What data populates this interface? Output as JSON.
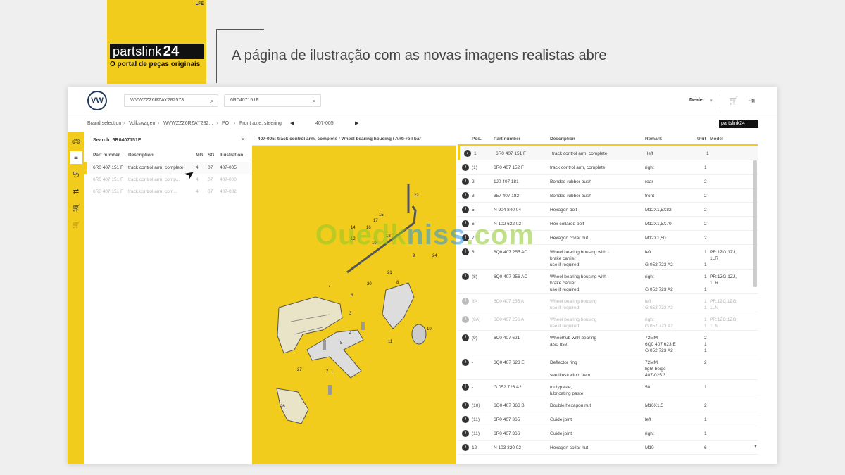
{
  "banner": {
    "logo_text": "partslink",
    "logo_num": "24",
    "tagline": "O portal de peças originais",
    "corner": "LFE",
    "headline": "A página de ilustração com as novas imagens realistas abre"
  },
  "topbar": {
    "vw_logo": "VW",
    "vin_search": "WVWZZZ6RZAY282573",
    "part_search": "6R0407151F",
    "dealer_label": "Dealer",
    "icons": [
      "search-icon",
      "cart-icon",
      "logout-icon"
    ]
  },
  "breadcrumb": {
    "items": [
      "Brand selection",
      "Volkswagen",
      "WVWZZZ6RZAY282...",
      "PO",
      "Front axle, steering"
    ],
    "illustration": "407-005",
    "mini_logo": "partslink24"
  },
  "sidebar": {
    "icons": [
      "car-icon",
      "list-search-icon",
      "percent-icon",
      "exchange-icon",
      "cart-stack-icon",
      "cart-icon"
    ]
  },
  "search_panel": {
    "title": "Search: 6R0407151F",
    "columns": [
      "Part number",
      "Description",
      "MG",
      "SG",
      "Illustration"
    ],
    "rows": [
      {
        "part": "6R0 407 151 F",
        "desc": "track control arm, complete",
        "mg": "4",
        "sg": "07",
        "illus": "407-005"
      },
      {
        "part": "6R0 407 151 F",
        "desc": "track control arm, comp...",
        "mg": "4",
        "sg": "07",
        "illus": "407-000"
      },
      {
        "part": "6R0 407 151 F",
        "desc": "track control arm, com...",
        "mg": "4",
        "sg": "07",
        "illus": "407-002"
      }
    ]
  },
  "illustration": {
    "title": "407-005: track control arm, complete / Wheel bearing housing / Anti-roll bar",
    "callouts": [
      "22",
      "14",
      "16",
      "17",
      "15",
      "18",
      "12",
      "19",
      "9",
      "24",
      "7",
      "21",
      "20",
      "6",
      "8",
      "3",
      "4",
      "10",
      "5",
      "11",
      "27",
      "2",
      "1",
      "26"
    ]
  },
  "parts_table": {
    "columns": [
      "Pos.",
      "Part number",
      "Description",
      "Remark",
      "Unit",
      "Model"
    ],
    "rows": [
      {
        "pos": "1",
        "part": "6R0 407 151 F",
        "desc": "track control arm, complete",
        "remark": "left",
        "unit": "1",
        "model": ""
      },
      {
        "pos": "(1)",
        "part": "6R0 407 152 F",
        "desc": "track control arm, complete",
        "remark": "right",
        "unit": "1",
        "model": ""
      },
      {
        "pos": "2",
        "part": "1J0 407 181",
        "desc": "Bonded rubber bush",
        "remark": "rear",
        "unit": "2",
        "model": ""
      },
      {
        "pos": "3",
        "part": "357 407 182",
        "desc": "Bonded rubber bush",
        "remark": "front",
        "unit": "2",
        "model": ""
      },
      {
        "pos": "5",
        "part": "N   904 840 04",
        "desc": "Hexagon bolt",
        "remark": "M12X1,5X82",
        "unit": "2",
        "model": ""
      },
      {
        "pos": "6",
        "part": "N   102 622 02",
        "desc": "Hex collared bolt",
        "remark": "M12X1,5X70",
        "unit": "2",
        "model": ""
      },
      {
        "pos": "7",
        "part": "",
        "desc": "Hexagon collar nut",
        "remark": "M12X1,50",
        "unit": "2",
        "model": ""
      },
      {
        "pos": "8",
        "part": "6Q0 407 255 AC",
        "desc": "Wheel bearing housing with -\nbrake carrier\nuse if required:",
        "remark": "left\n\nG   052 723 A2",
        "unit": "1\n\n1",
        "model": "PR:1ZG,1ZJ,\n1LR"
      },
      {
        "pos": "(8)",
        "part": "6Q0 407 256 AC",
        "desc": "Wheel bearing housing with -\nbrake carrier\nuse if required:",
        "remark": "right\n\nG   052 723 A2",
        "unit": "1\n\n1",
        "model": "PR:1ZG,1ZJ,\n1LR"
      },
      {
        "pos": "8A",
        "part": "6C0 407 255 A",
        "desc": "Wheel bearing housing\nuse if required:",
        "remark": "left\nG   052 723 A2",
        "unit": "1\n1",
        "model": "PR:1ZC,1ZG,\n1LN"
      },
      {
        "pos": "(8A)",
        "part": "6C0 407 256 A",
        "desc": "Wheel bearing housing\nuse if required:",
        "remark": "right\nG   052 723 A2",
        "unit": "1\n1",
        "model": "PR:1ZC,1ZG,\n1LN"
      },
      {
        "pos": "(9)",
        "part": "6C0 407 621",
        "desc": "Wheelhub with bearing\nalso use:",
        "remark": "72MM\n6Q0 407 623 E\nG   052 723 A2",
        "unit": "2\n1\n1",
        "model": ""
      },
      {
        "pos": "-",
        "part": "6Q0 407 623 E",
        "desc": "Deflector ring\n\nsee illustration, item",
        "remark": "72MM\nlight beige\n407-025.3",
        "unit": "2",
        "model": ""
      },
      {
        "pos": "-",
        "part": "G   052 723 A2",
        "desc": "molypaste,\nlubricating paste",
        "remark": "50",
        "unit": "1",
        "model": ""
      },
      {
        "pos": "(10)",
        "part": "6Q0 407 366 B",
        "desc": "Double hexagon nut",
        "remark": "M16X1,5",
        "unit": "2",
        "model": ""
      },
      {
        "pos": "(11)",
        "part": "6R0 407 365",
        "desc": "Guide joint",
        "remark": "left",
        "unit": "1",
        "model": ""
      },
      {
        "pos": "(11)",
        "part": "6R0 407 366",
        "desc": "Guide joint",
        "remark": "right",
        "unit": "1",
        "model": ""
      },
      {
        "pos": "12",
        "part": "N   103 320 02",
        "desc": "Hexagon collar nut",
        "remark": "M10",
        "unit": "6",
        "model": ""
      }
    ]
  },
  "watermark": {
    "part1": "Ouedk",
    "part2": "niss",
    "part3": ".com"
  },
  "colors": {
    "accent": "#f2cc1c",
    "dark": "#111111"
  }
}
